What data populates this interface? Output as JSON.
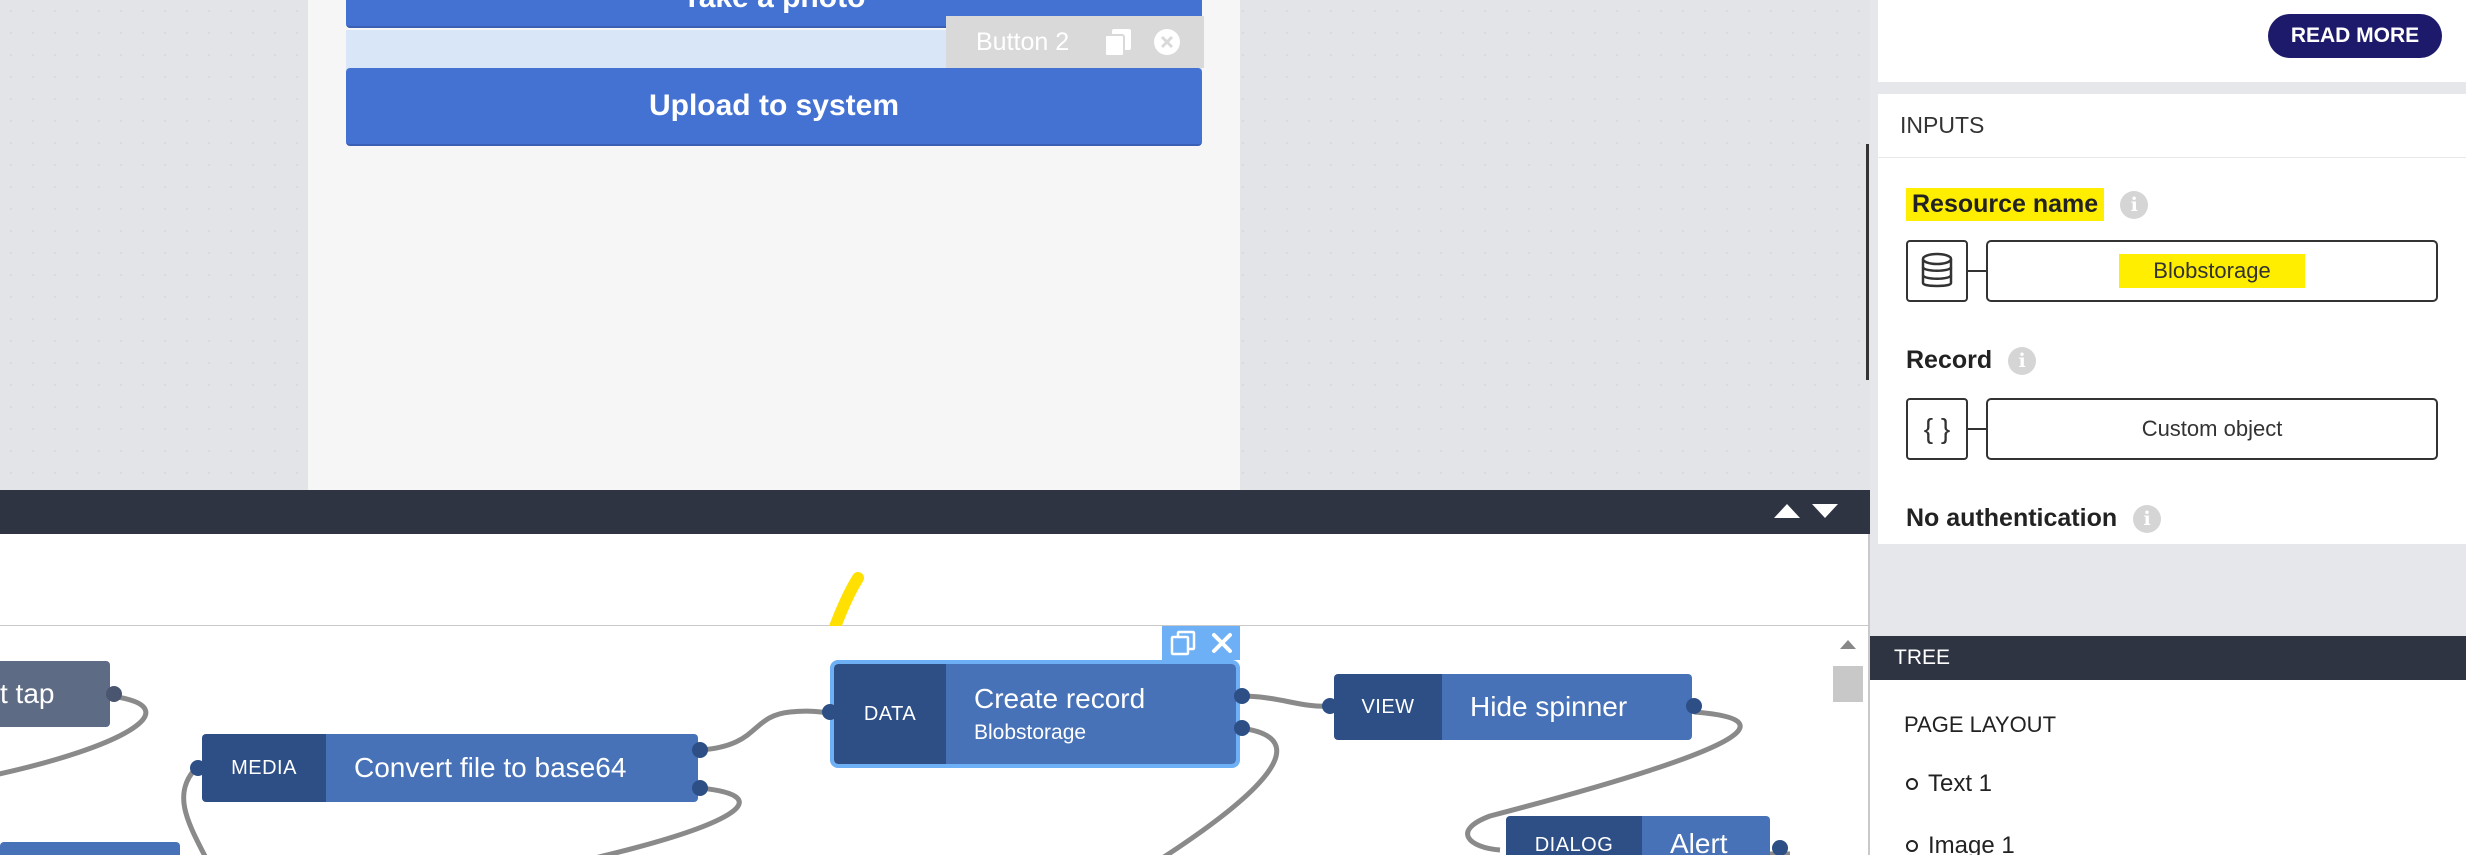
{
  "canvas": {
    "take_photo_label": "Take a photo",
    "button2_chip_label": "Button 2",
    "upload_label": "Upload to system"
  },
  "right_panel": {
    "read_more_label": "READ MORE",
    "inputs_title": "INPUTS",
    "resource_name": {
      "label": "Resource name",
      "value": "Blobstorage",
      "type_icon": "database-icon"
    },
    "record": {
      "label": "Record",
      "value": "Custom object",
      "type_icon": "curly-braces-icon"
    },
    "auth_label": "No authentication",
    "tree_title": "TREE",
    "page_layout_title": "PAGE LAYOUT",
    "tree_items": [
      "Text 1",
      "Image 1"
    ]
  },
  "logic": {
    "nodes": {
      "tap": {
        "label": "t tap"
      },
      "media": {
        "category": "MEDIA",
        "label": "Convert file to base64"
      },
      "data": {
        "category": "DATA",
        "label": "Create record",
        "sublabel": "Blobstorage"
      },
      "view": {
        "category": "VIEW",
        "label": "Hide spinner"
      },
      "dialog": {
        "category": "DIALOG",
        "label": "Alert"
      }
    }
  },
  "colors": {
    "primary_button": "#4472d3",
    "dark_bar": "#2f3443",
    "node_category": "#2d4f86",
    "node_body": "#4772b8",
    "selection": "#6db0f5",
    "highlight": "#ffee00",
    "read_more": "#1e1a6b"
  }
}
